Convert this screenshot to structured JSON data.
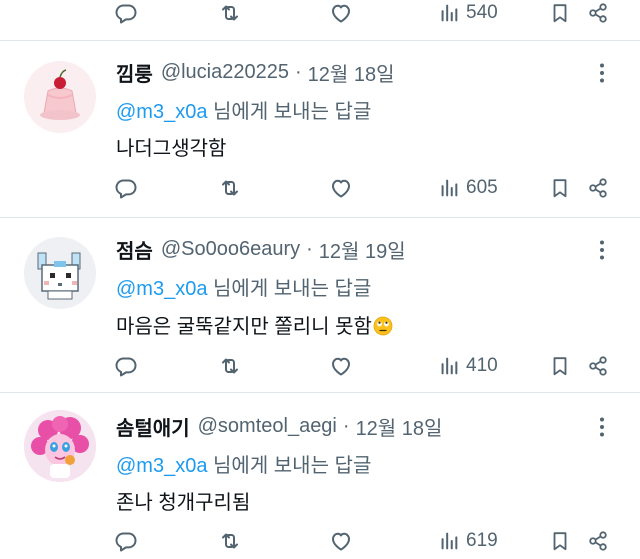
{
  "colors": {
    "accent": "#1d9bf0",
    "secondary_text": "#536471",
    "primary_text": "#0f1419",
    "divider": "#e1e6ea"
  },
  "top_actions": {
    "views": "540"
  },
  "tweets": [
    {
      "name": "낌룽",
      "handle": "@lucia220225",
      "separator": "·",
      "date": "12월 18일",
      "reply_to": "@m3_x0a",
      "reply_suffix": " 님에게 보내는 답글",
      "text": "나더그생각함",
      "views": "605",
      "avatar_icon": "jelly-pudding-avatar"
    },
    {
      "name": "점슴",
      "handle": "@So0oo6eaury",
      "separator": "·",
      "date": "12월 19일",
      "reply_to": "@m3_x0a",
      "reply_suffix": " 님에게 보내는 답글",
      "text": "마음은 굴뚝같지만 쫄리니 못함",
      "views": "410",
      "avatar_icon": "pixel-pachirisu-avatar",
      "emoji": "rolling-eyes-emoji"
    },
    {
      "name": "솜털애기",
      "handle": "@somteol_aegi",
      "separator": "·",
      "date": "12월 18일",
      "reply_to": "@m3_x0a",
      "reply_suffix": " 님에게 보내는 답글",
      "text": "존나 청개구리됨",
      "views": "619",
      "avatar_icon": "pink-pony-girl-avatar"
    }
  ],
  "icons": [
    "reply-icon",
    "retweet-icon",
    "like-icon",
    "views-icon",
    "bookmark-icon",
    "share-icon",
    "more-icon"
  ]
}
